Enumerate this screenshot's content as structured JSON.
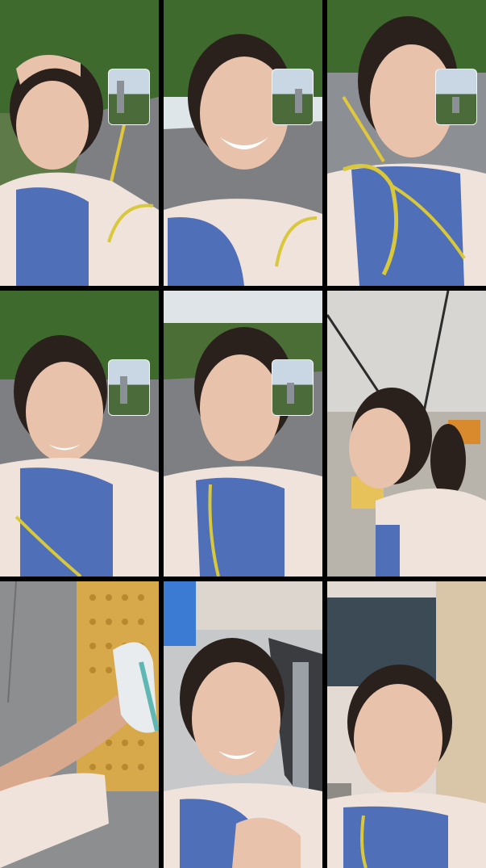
{
  "collage": {
    "frames": [
      {
        "id": 1,
        "scene": "selfie-park-road-hand-on-head",
        "pip": true
      },
      {
        "id": 2,
        "scene": "selfie-park-road-smiling",
        "pip": true
      },
      {
        "id": 3,
        "scene": "selfie-road-yellow-strap",
        "pip": true
      },
      {
        "id": 4,
        "scene": "selfie-park-road-talking",
        "pip": true
      },
      {
        "id": 5,
        "scene": "selfie-park-road-windy",
        "pip": true
      },
      {
        "id": 6,
        "scene": "indoor-station-profile",
        "pip": false
      },
      {
        "id": 7,
        "scene": "running-shoe-tactile-paving",
        "pip": false
      },
      {
        "id": 8,
        "scene": "escalator-selfie-laughing",
        "pip": false
      },
      {
        "id": 9,
        "scene": "indoor-hallway-selfie",
        "pip": false
      }
    ]
  },
  "colors": {
    "background": "#000000",
    "shirt": "#4f6fb8",
    "jacket": "#efe3dc",
    "strap": "#d8c83a",
    "skin": "#e8c2aa",
    "hair": "#2a211d",
    "foliage": "#3f6a2e",
    "road": "#7d7f82",
    "tactile-paving": "#d7a94a"
  }
}
